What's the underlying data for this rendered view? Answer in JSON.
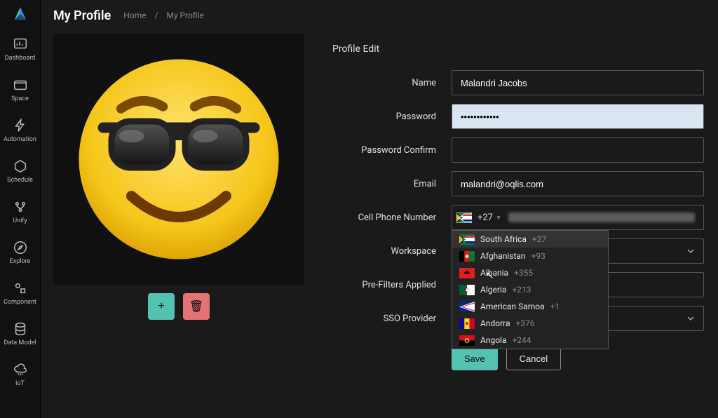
{
  "header": {
    "title": "My Profile",
    "breadcrumb_home": "Home",
    "breadcrumb_sep": "/",
    "breadcrumb_current": "My Profile"
  },
  "sidebar": {
    "items": [
      {
        "label": "Dashboard",
        "icon": "dashboard-icon"
      },
      {
        "label": "Space",
        "icon": "folder-icon"
      },
      {
        "label": "Automation",
        "icon": "bolt-icon"
      },
      {
        "label": "Schedule",
        "icon": "hexagon-icon"
      },
      {
        "label": "Unify",
        "icon": "merge-icon"
      },
      {
        "label": "Explore",
        "icon": "compass-icon"
      },
      {
        "label": "Component",
        "icon": "shapes-icon"
      },
      {
        "label": "Data Model",
        "icon": "layers-icon"
      },
      {
        "label": "IoT",
        "icon": "cloud-icon"
      }
    ]
  },
  "avatar_actions": {
    "add_label": "+",
    "delete_label": "🗑"
  },
  "form": {
    "title": "Profile Edit",
    "labels": {
      "name": "Name",
      "password": "Password",
      "password_confirm": "Password Confirm",
      "email": "Email",
      "cell": "Cell Phone Number",
      "workspace": "Workspace",
      "prefilters": "Pre-Filters Applied",
      "sso": "SSO Provider"
    },
    "values": {
      "name": "Malandri Jacobs",
      "password": "••••••••••••",
      "password_confirm": "",
      "email": "malandri@oqlis.com",
      "cell_prefix": "+27",
      "workspace": "",
      "prefilters": "",
      "sso": ""
    },
    "country_dropdown": [
      {
        "name": "South Africa",
        "code": "+27",
        "flag": "za",
        "selected": true
      },
      {
        "name": "Afghanistan",
        "code": "+93",
        "flag": "af"
      },
      {
        "name": "Albania",
        "code": "+355",
        "flag": "al"
      },
      {
        "name": "Algeria",
        "code": "+213",
        "flag": "dz"
      },
      {
        "name": "American Samoa",
        "code": "+1",
        "flag": "as"
      },
      {
        "name": "Andorra",
        "code": "+376",
        "flag": "ad"
      },
      {
        "name": "Angola",
        "code": "+244",
        "flag": "ao"
      }
    ],
    "buttons": {
      "save": "Save",
      "cancel": "Cancel"
    }
  }
}
